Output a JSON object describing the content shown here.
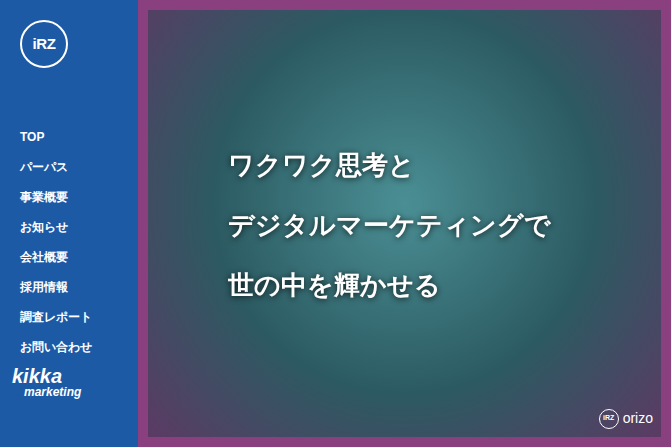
{
  "sidebar": {
    "logo": "iRZ",
    "nav": [
      {
        "label": "TOP"
      },
      {
        "label": "パーパス"
      },
      {
        "label": "事業概要"
      },
      {
        "label": "お知らせ"
      },
      {
        "label": "会社概要"
      },
      {
        "label": "採用情報"
      },
      {
        "label": "調査レポート"
      },
      {
        "label": "お問い合わせ"
      }
    ],
    "partner": {
      "name": "kikka",
      "sub": "marketing"
    }
  },
  "hero": {
    "lines": [
      "ワクワク思考と",
      "デジタルマーケティングで",
      "世の中を輝かせる"
    ],
    "brand": {
      "mark": "iRZ",
      "name": "orizo"
    }
  }
}
